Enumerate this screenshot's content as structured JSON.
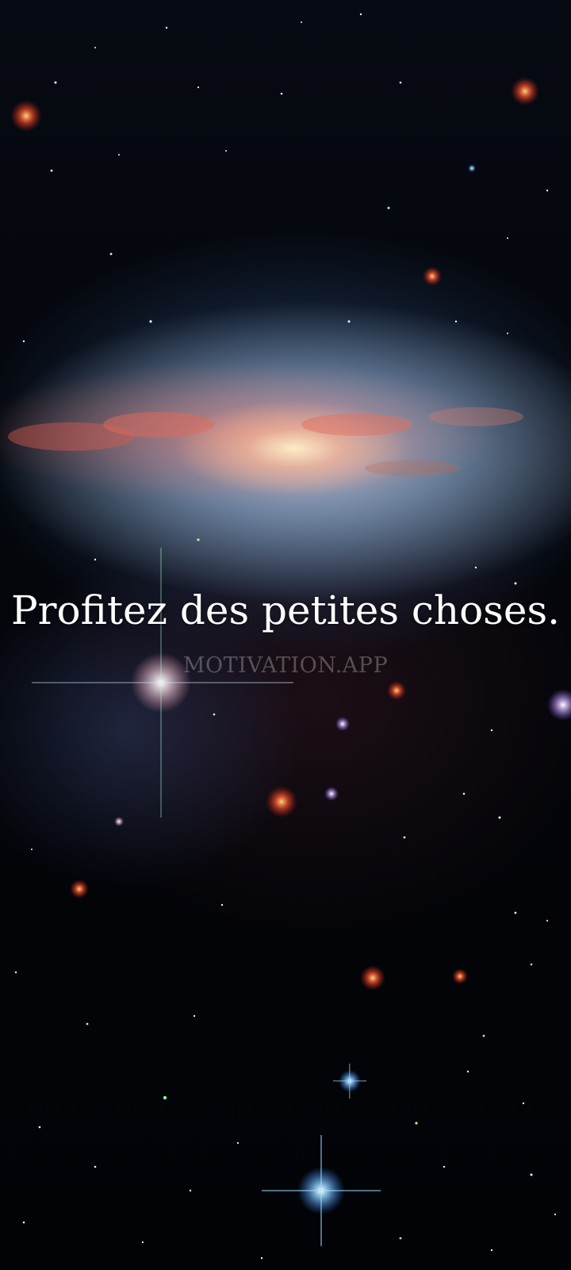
{
  "screen": {
    "quote_text": "Profitez des petites choses.",
    "watermark_text": "MOTIVATION.APP"
  },
  "colors": {
    "quote": "#ffffff",
    "watermark": "#c8c8d2",
    "background": "#04060c"
  }
}
